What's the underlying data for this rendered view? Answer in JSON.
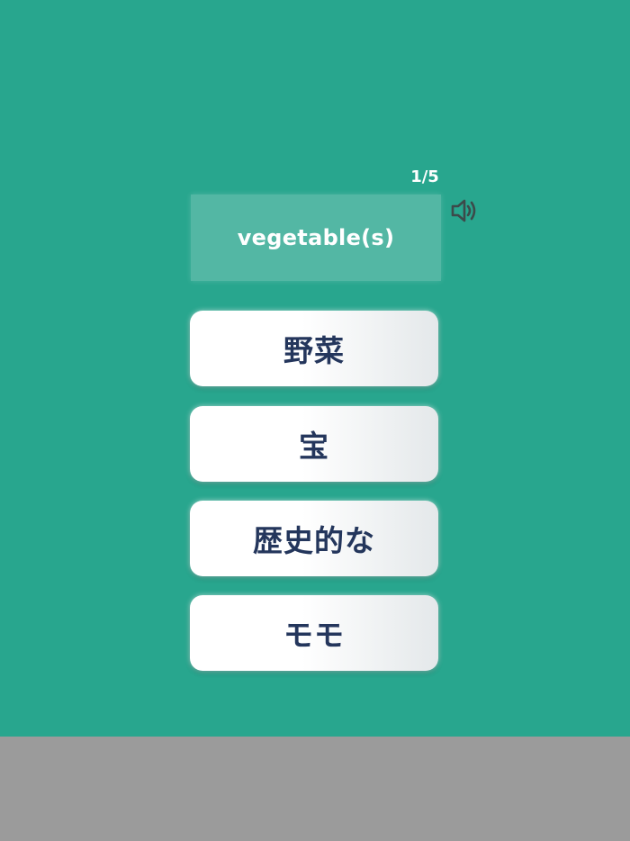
{
  "quiz": {
    "progress": "1/5",
    "word": "vegetable(s)",
    "speaker_icon": "speaker-icon",
    "options": [
      {
        "label": "野菜"
      },
      {
        "label": "宝"
      },
      {
        "label": "歴史的な"
      },
      {
        "label": "モモ"
      }
    ]
  },
  "colors": {
    "background": "#28a68e",
    "footer": "#9b9b9b",
    "option_text": "#24365c"
  }
}
